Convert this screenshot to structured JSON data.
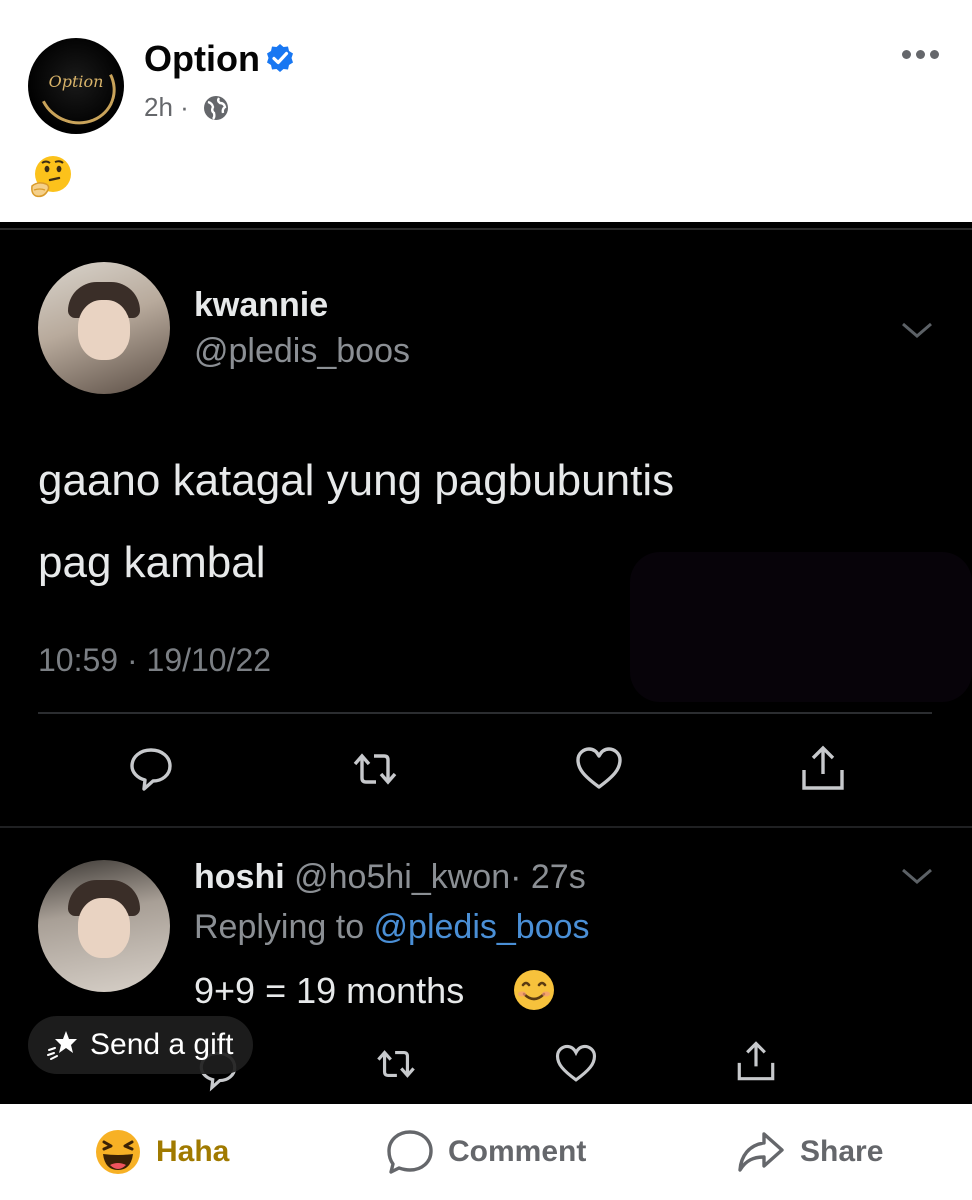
{
  "post": {
    "page_name": "Option",
    "avatar_logo_text": "Option",
    "time": "2h",
    "separator": "·",
    "caption_emoji": "thinking-face-emoji"
  },
  "tweet": {
    "author_name": "kwannie",
    "author_handle": "@pledis_boos",
    "text_line1": "gaano katagal yung pagbubuntis",
    "text_line2": "pag kambal",
    "timestamp": "10:59 · 19/10/22"
  },
  "reply": {
    "author_name": "hoshi",
    "author_handle": "@ho5hi_kwon",
    "age": "· 27s",
    "replying_prefix": "Replying to ",
    "replying_mention": "@pledis_boos",
    "text": "9+9 = 19 months"
  },
  "gift_chip": {
    "label": "Send a gift"
  },
  "action_bar": {
    "reaction_label": "Haha",
    "comment_label": "Comment",
    "share_label": "Share"
  },
  "colors": {
    "verified_blue": "#1877f2",
    "haha_label": "#a07a00",
    "facebook_grey": "#65676b",
    "mention_blue": "#4a8fd6"
  }
}
